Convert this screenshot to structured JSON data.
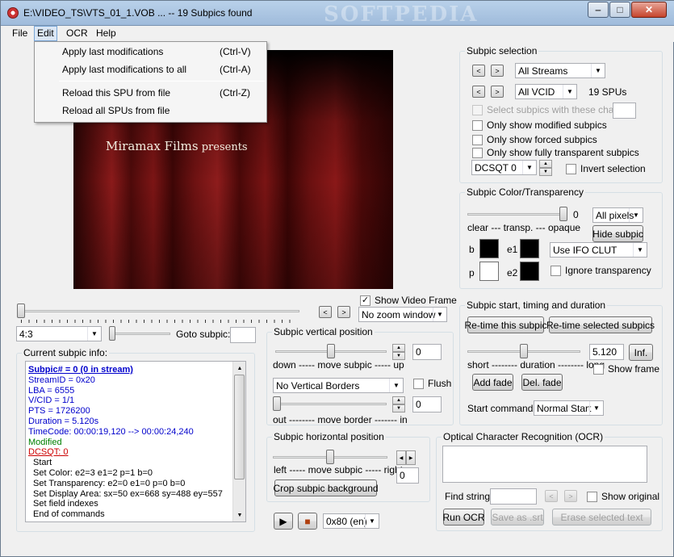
{
  "window": {
    "title": "E:\\VIDEO_TS\\VTS_01_1.VOB ... -- 19 Subpics found",
    "watermark": "SOFTPEDIA",
    "minimize": "‒",
    "maximize": "□",
    "close": "✕"
  },
  "menu": {
    "items": [
      "File",
      "Edit",
      "OCR",
      "Help"
    ]
  },
  "edit_menu": {
    "items": [
      {
        "label": "Apply last modifications",
        "shortcut": "(Ctrl-V)"
      },
      {
        "label": "Apply last modifications to all",
        "shortcut": "(Ctrl-A)"
      },
      {
        "label": "Reload this SPU from file",
        "shortcut": "(Ctrl-Z)"
      },
      {
        "label": "Reload all SPUs from file",
        "shortcut": ""
      }
    ]
  },
  "video": {
    "caption_main": "Miramax Films",
    "caption_rest": " presents"
  },
  "seek": {
    "prev": "<",
    "next": ">",
    "show_video_frame": "Show Video Frame",
    "zoom": "No zoom window",
    "position": 0.0
  },
  "aspect": {
    "value": "4:3"
  },
  "goto": {
    "label": "Goto subpic:",
    "value": ""
  },
  "current_info": {
    "legend": "Current subpic info:",
    "lines": [
      {
        "text": "Subpic# = 0 (0 in stream)",
        "color": "#0000cc",
        "bold": true,
        "underline": true
      },
      {
        "text": "StreamID = 0x20",
        "color": "#0000cc"
      },
      {
        "text": "LBA = 6555",
        "color": "#0000cc"
      },
      {
        "text": "V/CID = 1/1",
        "color": "#0000cc"
      },
      {
        "text": "PTS = 1726200",
        "color": "#0000cc"
      },
      {
        "text": "Duration = 5.120s",
        "color": "#0000cc"
      },
      {
        "text": "TimeCode: 00:00:19,120 --> 00:00:24,240",
        "color": "#0000cc"
      },
      {
        "text": "Modified",
        "color": "#008000"
      },
      {
        "text": "DCSQT: 0",
        "color": "#cc0000",
        "underline": true
      },
      {
        "text": "Start",
        "color": "#000000",
        "indent": true
      },
      {
        "text": "Set Color: e2=3 e1=2 p=1 b=0",
        "color": "#000000",
        "indent": true
      },
      {
        "text": "Set Transparency: e2=0 e1=0 p=0 b=0",
        "color": "#000000",
        "indent": true
      },
      {
        "text": "Set Display Area: sx=50 ex=668 sy=488 ey=557",
        "color": "#000000",
        "indent": true
      },
      {
        "text": "Set field indexes",
        "color": "#000000",
        "indent": true
      },
      {
        "text": "End of commands",
        "color": "#000000",
        "indent": true
      }
    ]
  },
  "vertical": {
    "legend": "Subpic vertical position",
    "move_label": "down ----- move subpic ----- up",
    "move_value": "0",
    "borders": "No Vertical Borders",
    "flush": "Flush",
    "border_label": "out -------- move border ------- in",
    "border_value": "0",
    "move_level": 0.5,
    "border_level": 0.0
  },
  "horizontal": {
    "legend": "Subpic horizontal position",
    "move_label": "left ----- move subpic ----- right",
    "value": "0",
    "crop_btn": "Crop subpic background",
    "move_level": 0.5
  },
  "player": {
    "play": "▶",
    "stop": "■",
    "stream": "0x80 (en)"
  },
  "selection": {
    "legend": "Subpic selection",
    "streams": "All Streams",
    "vcid": "All VCID",
    "spus": "19 SPUs",
    "select_chars": "Select subpics with these chars",
    "only_modified": "Only show modified subpics",
    "only_forced": "Only show forced subpics",
    "only_transparent": "Only show fully transparent subpics",
    "dcsqt": "DCSQT 0",
    "invert": "Invert selection"
  },
  "color": {
    "legend": "Subpic Color/Transparency",
    "value": "0",
    "pixels": "All pixels",
    "scale": "clear --- transp. --- opaque",
    "hide_btn": "Hide subpic",
    "b": "b",
    "e1": "e1",
    "p": "p",
    "e2": "e2",
    "clut": "Use IFO CLUT",
    "ignore": "Ignore transparency",
    "swatch_b": "#000000",
    "swatch_e1": "#000000",
    "swatch_p": "#ffffff",
    "swatch_e2": "#000000",
    "opacity_level": 1.0
  },
  "timing": {
    "legend": "Subpic start, timing and duration",
    "retime": "Re-time this subpic",
    "retime_sel": "Re-time selected subpics",
    "duration_label": "short -------- duration -------- long",
    "duration": "5.120",
    "inf": "Inf.",
    "show_frame": "Show frame",
    "add_fade": "Add fade",
    "del_fade": "Del. fade",
    "start_cmd_label": "Start command:",
    "start_cmd": "Normal Start",
    "duration_level": 0.5
  },
  "ocr": {
    "legend": "Optical Character Recognition (OCR)",
    "find_label": "Find string:",
    "find_value": "",
    "show_original": "Show original",
    "run": "Run OCR",
    "save": "Save as .srt",
    "erase": "Erase selected text"
  }
}
